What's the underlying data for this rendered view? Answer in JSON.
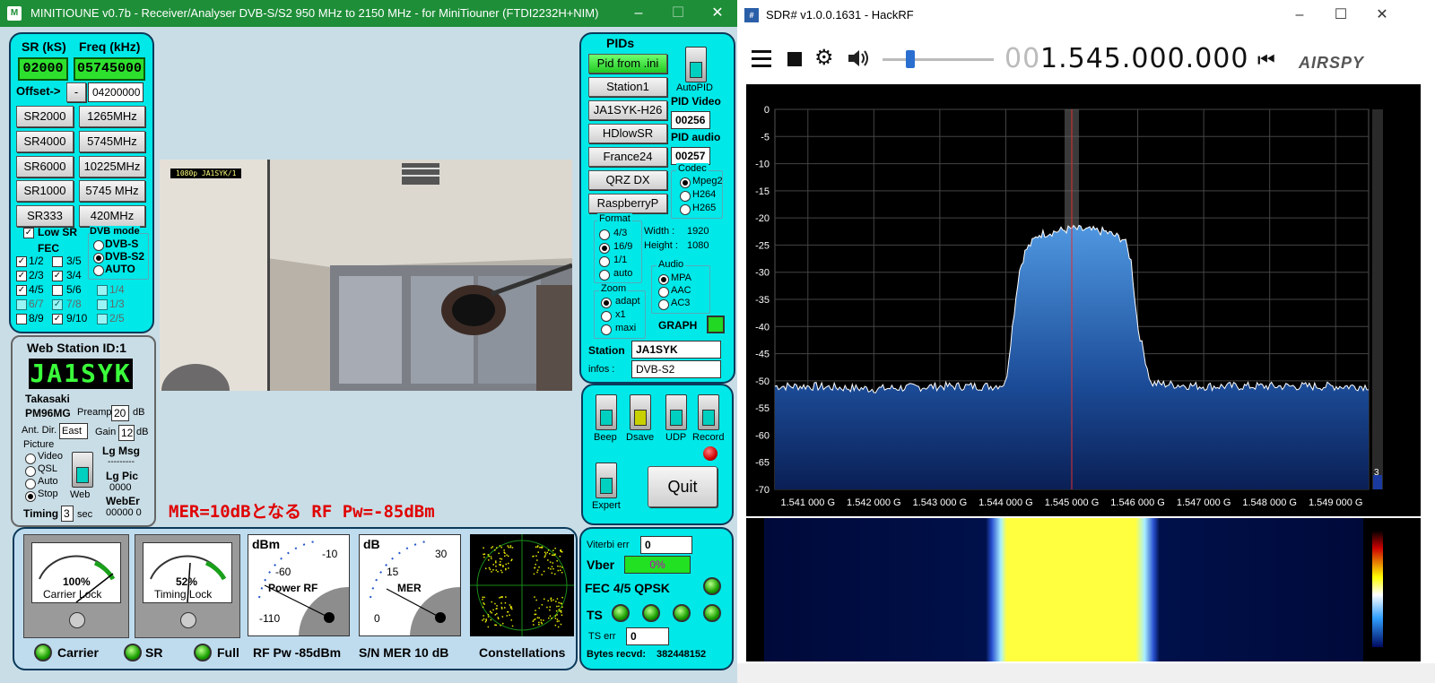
{
  "left_window": {
    "title": "MINITIOUNE v0.7b - Receiver/Analyser DVB-S/S2 950 MHz to 2150 MHz - for MiniTiouner (FTDI2232H+NIM)",
    "icon": "minitioune-app-icon",
    "tuning": {
      "sr_label": "SR (kS)",
      "freq_label": "Freq (kHz)",
      "sr_value": "02000",
      "freq_value": "05745000",
      "offset_label": "Offset->",
      "offset_sign": "-",
      "offset_value": "04200000",
      "sr_buttons": [
        "SR2000",
        "SR4000",
        "SR6000",
        "SR1000",
        "SR333"
      ],
      "freq_buttons": [
        "1265MHz",
        "5745MHz",
        "10225MHz",
        "5745 MHz",
        "420MHz"
      ],
      "low_sr_label": "Low SR",
      "fec_label": "FEC",
      "dvb_mode_label": "DVB mode",
      "dvb_modes": [
        "DVB-S",
        "DVB-S2",
        "AUTO"
      ],
      "fec_items": [
        "1/2",
        "3/5",
        "2/3",
        "3/4",
        "4/5",
        "5/6",
        "1/4",
        "6/7",
        "7/8",
        "1/3",
        "8/9",
        "9/10",
        "2/5"
      ]
    },
    "web_station": {
      "title": "Web Station ID:1",
      "callsign": "JA1SYK",
      "city": "Takasaki",
      "locator": "PM96MG",
      "preamp_label": "Preamp",
      "preamp_value": "20",
      "db_label": "dB",
      "ant_dir_label": "Ant. Dir.",
      "ant_dir_value": "East",
      "gain_label": "Gain",
      "gain_value": "12",
      "picture_label": "Picture",
      "picture_options": [
        "Video",
        "QSL",
        "Auto",
        "Stop"
      ],
      "web_label": "Web",
      "lg_msg_label": "Lg Msg",
      "lg_msg_value": "---------",
      "lg_pic_label": "Lg Pic",
      "lg_pic_value": "0000",
      "weber_label": "WebEr",
      "weber_value": "00000  0",
      "timing_label": "Timing",
      "timing_value": "3",
      "sec_label": "sec"
    },
    "video_overlay_text": "1080p  JA1SYK/1",
    "annotation": "MER=10dBとなる  RF Pw=-85dBm",
    "pids": {
      "title": "PIDs",
      "buttons": [
        "Pid from .ini",
        "Station1",
        "JA1SYK-H26",
        "HDlowSR",
        "France24",
        "QRZ DX",
        "RaspberryP"
      ],
      "autopid_label": "AutoPID",
      "pid_video_label": "PID Video",
      "pid_video_value": "00256",
      "pid_audio_label": "PID audio",
      "pid_audio_value": "00257",
      "codec_label": "Codec",
      "codecs": [
        "Mpeg2",
        "H264",
        "H265"
      ],
      "format_label": "Format",
      "formats": [
        "4/3",
        "16/9",
        "1/1",
        "auto"
      ],
      "width_label": "Width :",
      "width_value": "1920",
      "height_label": "Height :",
      "height_value": "1080",
      "audio_label": "Audio",
      "audios": [
        "MPA",
        "AAC",
        "AC3"
      ],
      "zoom_label": "Zoom",
      "zooms": [
        "adapt",
        "x1",
        "maxi"
      ],
      "graph_label": "GRAPH",
      "station_label": "Station",
      "station_value": "JA1SYK",
      "infos_label": "infos :",
      "infos_value": "DVB-S2"
    },
    "controls": {
      "beep": "Beep",
      "dsave": "Dsave",
      "udp": "UDP",
      "record": "Record",
      "expert": "Expert",
      "quit": "Quit"
    },
    "meters": {
      "carrier_lock_pct": "100%",
      "carrier_lock_label": "Carrier Lock",
      "carrier_lock_fraction": 1.0,
      "timing_lock_pct": "52%",
      "timing_lock_label": "Timing Lock",
      "timing_lock_fraction": 0.52,
      "power_unit": "dBm",
      "power_ticks": [
        "-60",
        "-10",
        "-110"
      ],
      "power_label": "Power RF",
      "mer_unit": "dB",
      "mer_ticks": [
        "15",
        "30",
        "0"
      ],
      "mer_label": "MER",
      "status_carrier": "Carrier",
      "status_sr": "SR",
      "status_full": "Full",
      "rf_pw": "RF Pw -85dBm",
      "sn_mer": "S/N MER  10 dB",
      "constellations": "Constellations"
    },
    "stats": {
      "viterbi_label": "Viterbi err",
      "viterbi_value": "0",
      "vber_label": "Vber",
      "vber_value": "0%",
      "fec_info": "FEC 4/5 QPSK",
      "ts_label": "TS",
      "ts_err_label": "TS err",
      "ts_err_value": "0",
      "bytes_label": "Bytes recvd:",
      "bytes_value": "382448152"
    }
  },
  "right_window": {
    "title": "SDR# v1.0.0.1631 - HackRF",
    "frequency_dim": "00",
    "frequency": "1.545.000.000",
    "logo": "AIRSPY",
    "colors": {
      "title_green": "#1e8e38",
      "panel_cyan": "#00e8e8",
      "spectrum_blue": "#2a5fa8"
    }
  },
  "chart_data": {
    "type": "line",
    "title": "",
    "xlabel": "",
    "ylabel": "",
    "x_tick_labels": [
      "1.541 000 G",
      "1.542 000 G",
      "1.543 000 G",
      "1.544 000 G",
      "1.545 000 G",
      "1.546 000 G",
      "1.547 000 G",
      "1.548 000 G",
      "1.549 000 G"
    ],
    "y_tick_labels": [
      "0",
      "-5",
      "-10",
      "-15",
      "-20",
      "-25",
      "-30",
      "-35",
      "-40",
      "-45",
      "-50",
      "-55",
      "-60",
      "-65",
      "-70"
    ],
    "xlim": [
      1.5405,
      1.5495
    ],
    "ylim": [
      -70,
      0
    ],
    "grid": true,
    "series": [
      {
        "x": [
          1.5405,
          1.541,
          1.542,
          1.543,
          1.5438,
          1.544,
          1.5441,
          1.5442,
          1.5443,
          1.5445,
          1.545,
          1.5455,
          1.5458,
          1.5459,
          1.546,
          1.5462,
          1.547,
          1.548,
          1.549,
          1.5495
        ],
        "y": [
          -51,
          -51,
          -51.5,
          -51,
          -51,
          -50.5,
          -40,
          -30,
          -26,
          -23,
          -22,
          -22.5,
          -24,
          -28,
          -40,
          -50.5,
          -51,
          -51,
          -51,
          -51
        ]
      }
    ],
    "center_marker": 1.545,
    "scroll_value": "3"
  }
}
